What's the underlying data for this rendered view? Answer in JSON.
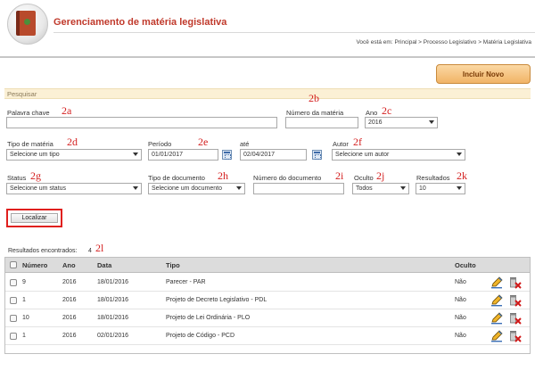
{
  "header": {
    "app_title": "Gerenciamento de matéria legislativa",
    "breadcrumb": "Você está em: Principal > Processo Legislativo > Matéria Legislativa"
  },
  "actions": {
    "incluir_label": "Incluir Novo"
  },
  "search": {
    "section_title": "Pesquisar",
    "palavra_chave_label": "Palavra chave",
    "palavra_chave_value": "",
    "numero_materia_label": "Número da matéria",
    "numero_materia_value": "",
    "ano_label": "Ano",
    "ano_value": "2016",
    "tipo_materia_label": "Tipo de matéria",
    "tipo_materia_value": "Selecione um tipo",
    "periodo_label": "Período",
    "periodo_inicio": "01/01/2017",
    "ate_label": "até",
    "periodo_fim": "02/04/2017",
    "autor_label": "Autor",
    "autor_value": "Selecione um autor",
    "status_label": "Status",
    "status_value": "Selecione um status",
    "tipo_documento_label": "Tipo de documento",
    "tipo_documento_value": "Selecione um documento",
    "numero_documento_label": "Número do documento",
    "numero_documento_value": "",
    "oculto_label": "Oculto",
    "oculto_value": "Todos",
    "resultados_label": "Resultados",
    "resultados_value": "10",
    "localizar_label": "Localizar"
  },
  "annotations": {
    "a2a": "2a",
    "a2b": "2b",
    "a2c": "2c",
    "a2d": "2d",
    "a2e": "2e",
    "a2f": "2f",
    "a2g": "2g",
    "a2h": "2h",
    "a2i": "2i",
    "a2j": "2j",
    "a2k": "2k",
    "a2l": "2l"
  },
  "results": {
    "count_label": "Resultados encontrados:",
    "count_value": "4",
    "columns": [
      "Número",
      "Ano",
      "Data",
      "Tipo",
      "Oculto"
    ],
    "rows": [
      {
        "numero": "9",
        "ano": "2016",
        "data": "18/01/2016",
        "tipo": "Parecer - PAR",
        "oculto": "Não"
      },
      {
        "numero": "1",
        "ano": "2016",
        "data": "18/01/2016",
        "tipo": "Projeto de Decreto Legislativo - PDL",
        "oculto": "Não"
      },
      {
        "numero": "10",
        "ano": "2016",
        "data": "18/01/2016",
        "tipo": "Projeto de Lei Ordinária - PLO",
        "oculto": "Não"
      },
      {
        "numero": "1",
        "ano": "2016",
        "data": "02/01/2016",
        "tipo": "Projeto de Código - PCD",
        "oculto": "Não"
      }
    ]
  },
  "icons": {
    "logo": "book-logo-icon",
    "calendar": "calendar-icon",
    "edit": "pencil-edit-icon",
    "delete": "trash-delete-icon"
  }
}
